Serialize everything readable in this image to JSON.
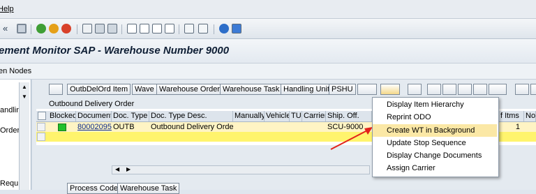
{
  "menubar": {
    "help": "Help"
  },
  "title": "ement Monitor SAP - Warehouse Number 9000",
  "subbar": {
    "label": "en Nodes"
  },
  "left_panel": {
    "items": [
      "andlin",
      "Order",
      "Requ"
    ]
  },
  "toolbar_buttons": [
    "OutbDelOrd Item",
    "Wave",
    "Warehouse Order",
    "Warehouse Task",
    "Handling Unit",
    "PSHU"
  ],
  "table_title": "Outbound Delivery Order",
  "columns": [
    "Blocked",
    "Document",
    "Doc. Type",
    "Doc. Type Desc.",
    "Manually",
    "Vehicle",
    "TU",
    "Carrier",
    "Ship. Off.",
    "",
    "",
    "f Itms",
    "No."
  ],
  "row": {
    "document": "80002095",
    "doc_type": "OUTB",
    "doc_type_desc": "Outbound Delivery Order",
    "ship_off": "SCU-9000",
    "items": "1"
  },
  "context_menu": {
    "items": [
      "Display Item Hierarchy",
      "Reprint ODO",
      "Create WT in Background",
      "Update Stop Sequence",
      "Display Change Documents",
      "Assign Carrier"
    ],
    "selected": "Create WT in Background"
  },
  "bottom_buttons": [
    "Process Code",
    "Warehouse Task"
  ],
  "colors": {
    "highlight_row": "#fff46d",
    "selected_row": "#fff4c4",
    "menu_selected": "#fbe8a6",
    "arrow": "#e3231b",
    "status_green": "#22c02a"
  }
}
